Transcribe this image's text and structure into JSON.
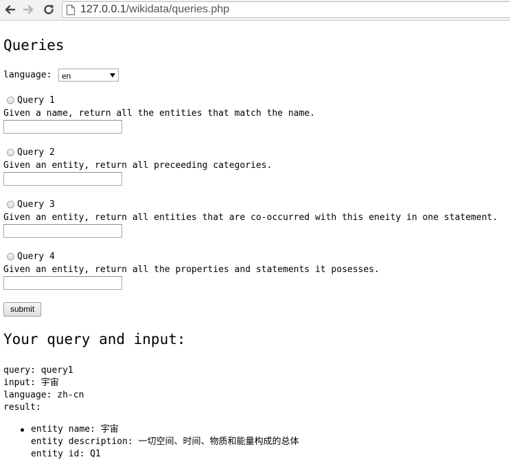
{
  "browser": {
    "url_host": "127.0.0.1",
    "url_path": "/wikidata/queries.php"
  },
  "page": {
    "title": "Queries",
    "language_label": "language:",
    "language_selected": "en",
    "queries": [
      {
        "label": "Query 1",
        "description": "Given a name, return all the entities that match the name."
      },
      {
        "label": "Query 2",
        "description": "Given an entity, return all preceeding categories."
      },
      {
        "label": "Query 3",
        "description": "Given an entity, return all entities that are co-occurred with this eneity in one statement."
      },
      {
        "label": "Query 4",
        "description": "Given an entity, return all the properties and statements it posesses."
      }
    ],
    "submit_label": "submit"
  },
  "result": {
    "title": "Your query and input:",
    "query_line": "query: query1",
    "input_line": "input: 宇宙",
    "language_line": "language: zh-cn",
    "result_label": "result:",
    "entities": [
      {
        "name_line": "entity name: 宇宙",
        "description_line": "entity description: 一切空间、时间、物质和能量构成的总体",
        "id_line": "entity id: Q1"
      }
    ]
  }
}
